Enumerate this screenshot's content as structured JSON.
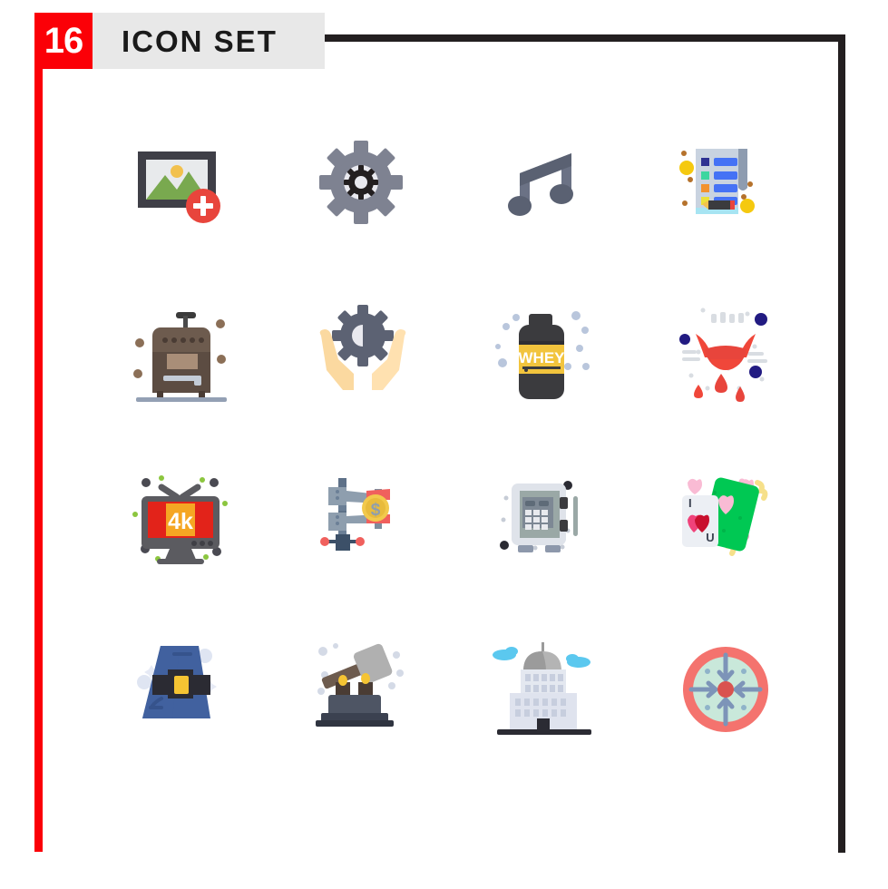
{
  "header": {
    "count": "16",
    "title": "ICON SET",
    "count_bg": "#fb0007",
    "count_fg": "#ffffff",
    "title_bg": "#e8e8e8",
    "title_fg": "#1a1a1a"
  },
  "frame": {
    "left_rail_color": "#fb0007",
    "right_rail_color": "#231f20",
    "top_rail_color": "#231f20"
  },
  "grid": {
    "columns": 4,
    "rows": 4,
    "total": 16
  },
  "icons": [
    {
      "index": 1,
      "name": "add-image-icon",
      "label": "Add Image",
      "row": 1,
      "col": 1,
      "colors": [
        "#3f3f47",
        "#e8eaec",
        "#79a94f",
        "#f2c14e",
        "#e8453c"
      ]
    },
    {
      "index": 2,
      "name": "gear-settings-icon",
      "label": "Settings Gear",
      "row": 1,
      "col": 2,
      "colors": [
        "#7e8291",
        "#e9e9ef",
        "#231f20"
      ]
    },
    {
      "index": 3,
      "name": "music-note-icon",
      "label": "Music Note",
      "row": 1,
      "col": 3,
      "colors": [
        "#5a6172",
        "#6b7285"
      ]
    },
    {
      "index": 4,
      "name": "checklist-notepad-icon",
      "label": "Checklist Notepad",
      "row": 1,
      "col": 4,
      "colors": [
        "#c9d3e0",
        "#8e9cb0",
        "#4572f5",
        "#2e3192",
        "#3dd6a0",
        "#f2922e",
        "#ece13a",
        "#a7e4f2",
        "#f5c90f",
        "#e8453c"
      ]
    },
    {
      "index": 5,
      "name": "coffee-machine-icon",
      "label": "Coffee Machine",
      "row": 2,
      "col": 1,
      "colors": [
        "#6d5b4e",
        "#5c4c42",
        "#a98e78",
        "#8b7362",
        "#3b3b3b",
        "#93a0b4"
      ]
    },
    {
      "index": 6,
      "name": "hands-gear-support-icon",
      "label": "Hands Holding Gear",
      "row": 2,
      "col": 2,
      "colors": [
        "#fbd9a0",
        "#ffe1b0",
        "#5c6273"
      ]
    },
    {
      "index": 7,
      "name": "whey-protein-icon",
      "label": "Whey Protein Jar",
      "row": 2,
      "col": 3,
      "colors": [
        "#3b3b3e",
        "#2f2f33",
        "#f2c43d",
        "#b9c6dc"
      ]
    },
    {
      "index": 8,
      "name": "vampire-fangs-icon",
      "label": "Vampire Fangs",
      "row": 2,
      "col": 4,
      "colors": [
        "#f0473a",
        "#e8453c",
        "#221b82",
        "#d9dde2"
      ]
    },
    {
      "index": 9,
      "name": "four-k-tv-icon",
      "label": "4K Television",
      "row": 3,
      "col": 1,
      "colors": [
        "#5b5b60",
        "#e2231a",
        "#f5a623",
        "#ffffff",
        "#8cc63f",
        "#4a4a52"
      ]
    },
    {
      "index": 10,
      "name": "money-clamp-icon",
      "label": "Money Clamp",
      "row": 3,
      "col": 2,
      "colors": [
        "#8e9eae",
        "#7d8d9d",
        "#f0605d",
        "#f2c94c",
        "#3c5068",
        "#6b7f96"
      ]
    },
    {
      "index": 11,
      "name": "safe-vault-icon",
      "label": "Safe Vault",
      "row": 3,
      "col": 3,
      "colors": [
        "#dfe3ea",
        "#9aa8a6",
        "#7d8894",
        "#3b3b3e",
        "#b9c2cf"
      ]
    },
    {
      "index": 12,
      "name": "love-playing-cards-icon",
      "label": "Love Playing Cards",
      "row": 3,
      "col": 4,
      "colors": [
        "#00c853",
        "#eceff4",
        "#c8102e",
        "#f0427a",
        "#f9bbd4",
        "#f6e08a"
      ]
    },
    {
      "index": 13,
      "name": "pilgrim-hat-icon",
      "label": "Pilgrim Hat",
      "row": 4,
      "col": 1,
      "colors": [
        "#41619f",
        "#36538c",
        "#2b2b33",
        "#f5c433",
        "#dfe5f2"
      ]
    },
    {
      "index": 14,
      "name": "hammer-anvil-icon",
      "label": "Hammer and Anvil",
      "row": 4,
      "col": 2,
      "colors": [
        "#b0b0b0",
        "#6d5b4e",
        "#4e5564",
        "#3b4150",
        "#f2c94c",
        "#d4dae6"
      ]
    },
    {
      "index": 15,
      "name": "capitol-building-icon",
      "label": "Capitol Building",
      "row": 4,
      "col": 3,
      "colors": [
        "#c7cede",
        "#e4e8f0",
        "#9b9b9b",
        "#2b2b33",
        "#5bc8ef"
      ]
    },
    {
      "index": 16,
      "name": "focus-target-icon",
      "label": "Focus Target",
      "row": 4,
      "col": 4,
      "colors": [
        "#f4736e",
        "#c9e8da",
        "#7d94b8",
        "#d9534f"
      ]
    }
  ]
}
